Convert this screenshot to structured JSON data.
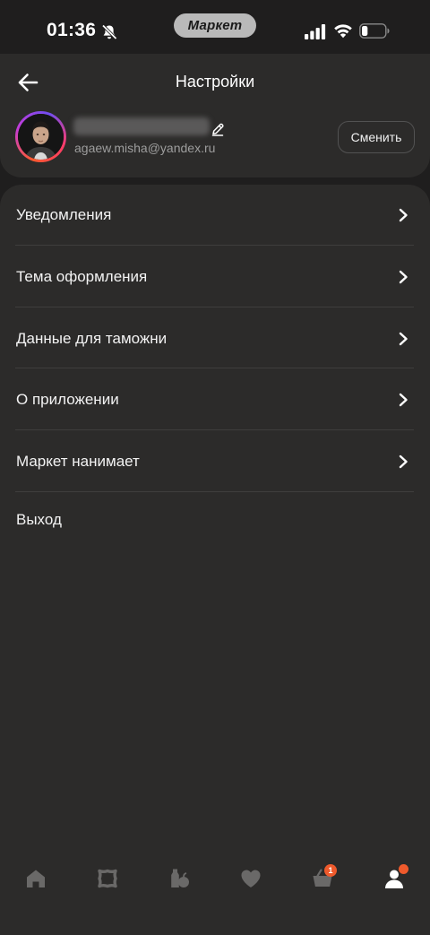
{
  "status_bar": {
    "time": "01:36",
    "app_badge": "Маркет",
    "icons": [
      "bell-off-icon",
      "signal-icon",
      "wifi-icon",
      "battery-icon"
    ],
    "battery_level": 0.25
  },
  "header": {
    "title": "Настройки",
    "back_icon": "arrow-left-icon"
  },
  "profile": {
    "email": "agaew.misha@yandex.ru",
    "change_label": "Сменить",
    "avatar_ring_colors": [
      "#ff5a2e",
      "#c43cd9",
      "#6f4df1"
    ]
  },
  "menu": {
    "items": [
      {
        "label": "Уведомления",
        "icon": "chevron-right-icon"
      },
      {
        "label": "Тема оформления",
        "icon": "chevron-right-icon"
      },
      {
        "label": "Данные для таможни",
        "icon": "chevron-right-icon"
      },
      {
        "label": "О приложении",
        "icon": "chevron-right-icon"
      },
      {
        "label": "Маркет нанимает",
        "icon": "chevron-right-icon"
      },
      {
        "label": "Выход"
      }
    ]
  },
  "tab_bar": {
    "items": [
      {
        "name": "home",
        "icon": "home-icon"
      },
      {
        "name": "catalog",
        "icon": "catalog-icon"
      },
      {
        "name": "groceries",
        "icon": "groceries-icon"
      },
      {
        "name": "favorites",
        "icon": "heart-icon"
      },
      {
        "name": "cart",
        "icon": "basket-icon",
        "badge": "1"
      },
      {
        "name": "profile",
        "icon": "profile-icon",
        "active": true
      }
    ]
  },
  "colors": {
    "background": "#1f1e1e",
    "card": "#2c2b2a",
    "accent": "#ef5a2c",
    "text": "#f3f3f3",
    "muted": "#9d9d9d"
  }
}
